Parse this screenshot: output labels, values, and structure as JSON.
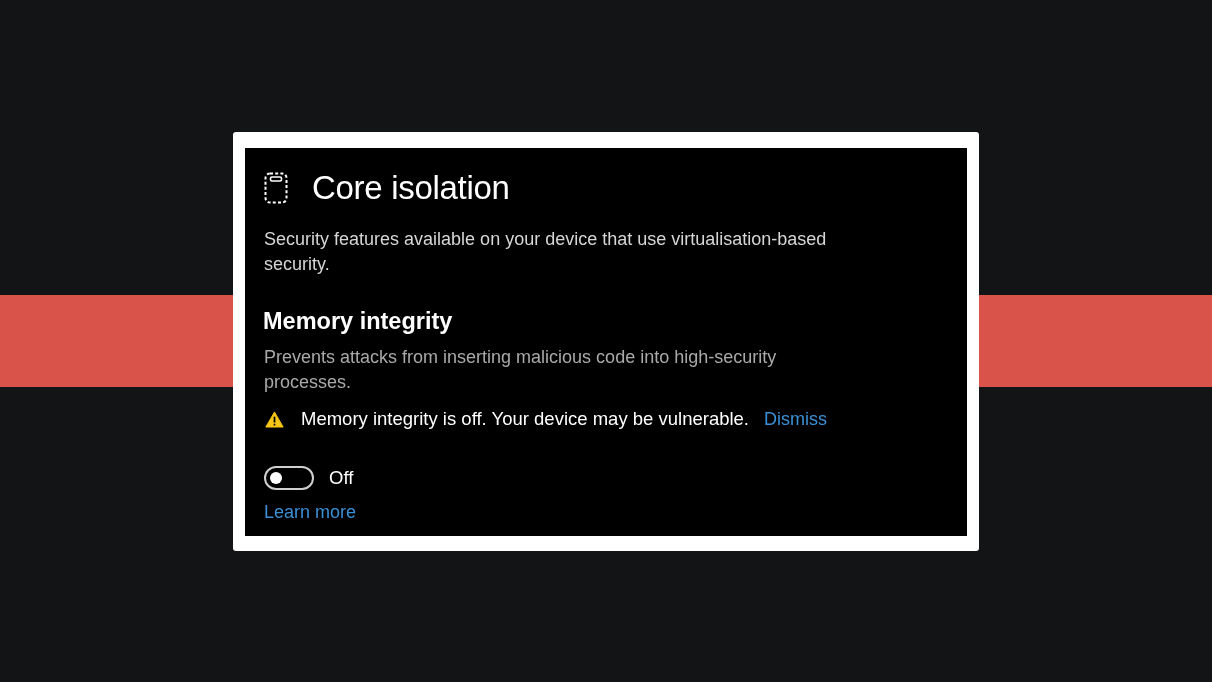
{
  "panel": {
    "title": "Core isolation",
    "description": "Security features available on your device that use virtualisation-based security.",
    "section": {
      "heading": "Memory integrity",
      "description": "Prevents attacks from inserting malicious code into high-security processes.",
      "warning": {
        "message": "Memory integrity is off. Your device may be vulnerable.",
        "action": "Dismiss"
      },
      "toggle": {
        "on": false,
        "label": "Off"
      },
      "link": "Learn more"
    }
  }
}
